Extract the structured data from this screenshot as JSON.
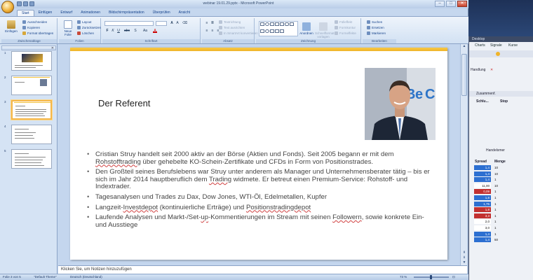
{
  "window": {
    "title": "webinar 19.01.29.pptx - Microsoft PowerPoint",
    "minimize": "–",
    "maximize": "□",
    "close": "✕"
  },
  "ribbon": {
    "tabs": [
      "Start",
      "Einfügen",
      "Entwurf",
      "Animationen",
      "Bildschirmpräsentation",
      "Überprüfen",
      "Ansicht"
    ],
    "active_tab": "Start",
    "clipboard": {
      "paste": "Einfügen",
      "cut": "Ausschneiden",
      "copy": "Kopieren",
      "format_painter": "Format übertragen",
      "group_label": "Zwischenablage"
    },
    "slides": {
      "new_slide": "Neue Folie",
      "layout": "Layout",
      "reset": "Zurücksetzen",
      "delete": "Löschen",
      "group_label": "Folien"
    },
    "font": {
      "group_label": "Schriftart",
      "bold": "F",
      "italic": "K",
      "underline": "U",
      "strike": "abc",
      "shadow": "S",
      "case": "Aa",
      "color": "A"
    },
    "paragraph": {
      "text_direction": "Textrichtung",
      "align_text": "Text ausrichten",
      "smartart": "In SmartArt konvertieren",
      "group_label": "Absatz"
    },
    "drawing": {
      "arrange": "Anordnen",
      "quick_styles": "Schnellformat-vorlagen",
      "fill": "Fülleffekt",
      "outline": "Formkontur",
      "effects": "Formeffekte",
      "group_label": "Zeichnung"
    },
    "editing": {
      "find": "Suchen",
      "replace": "Ersetzen",
      "select": "Markieren",
      "group_label": "Bearbeiten"
    }
  },
  "thumbnails": [
    {
      "number": "1"
    },
    {
      "number": "2"
    },
    {
      "number": "3",
      "selected": true
    },
    {
      "number": "4"
    },
    {
      "number": "5"
    }
  ],
  "slide": {
    "title": "Der Referent",
    "bullets": [
      {
        "parts": [
          "Cristian Struy handelt seit 2000 aktiv an der Börse (Aktien und Fonds). Seit 2005 begann er mit dem ",
          "Rohstofftrading",
          " über gehebelte KO-Schein-Zertifikate und CFDs in Form von Positionstrades."
        ]
      },
      {
        "parts": [
          "Den Großteil seines Berufslebens war Struy unter anderem als Manager und Unternehmensberater tätig – bis er sich im Jahr 2014 hauptberuflich dem ",
          "Trading",
          " widmete. Er betreut einen Premium-Service: Rohstoff- und Indextrader."
        ]
      },
      {
        "parts": [
          "Tagesanalysen und Trades zu Dax, Dow Jones, WTI-Öl, Edelmetallen, Kupfer"
        ]
      },
      {
        "parts": [
          "Langzeit-",
          "Investdepot",
          " (kontinuierliche Erträge) und ",
          "Positionstradingdepot",
          ""
        ]
      },
      {
        "parts": [
          "Laufende Analysen und Markt-/Set-",
          "up",
          "-Kommentierungen im Stream mit seinen ",
          "Followern",
          ", sowie konkrete Ein- und Ausstiege"
        ]
      }
    ]
  },
  "notes": {
    "placeholder": "Klicken Sie, um Notizen hinzuzufügen"
  },
  "statusbar": {
    "slide_info": "Folie 3 von 5",
    "theme": "\"Default Theme\"",
    "language": "Deutsch (Deutschland)",
    "zoom": "73 %"
  },
  "trader": {
    "title": "Desktop",
    "menu": [
      "Charts",
      "Signale",
      "Kurse"
    ],
    "tab_label": "Handlung",
    "search_text": "Zusammenf.",
    "col_sl": "Schlu...",
    "col_stop": "Stop",
    "col_spread": "Spread",
    "col_menge": "Menge",
    "handel_label": "Handelsmer",
    "quotes": [
      {
        "spread": "1,4",
        "menge": "10",
        "color": "#2c6fd1"
      },
      {
        "spread": "1,4",
        "menge": "10",
        "color": "#2c6fd1"
      },
      {
        "spread": "1,4",
        "menge": "1",
        "color": "#2c6fd1"
      },
      {
        "spread": "11,00",
        "menge": "10",
        "color": "#ffffff"
      },
      {
        "spread": "0,09",
        "menge": "1",
        "color": "#c23030"
      },
      {
        "spread": "1,8",
        "menge": "1",
        "color": "#2c6fd1"
      },
      {
        "spread": "1,75",
        "menge": "1",
        "color": "#2c6fd1"
      },
      {
        "spread": "1,8",
        "menge": "1",
        "color": "#c23030"
      },
      {
        "spread": "3,3",
        "menge": "1",
        "color": "#c23030"
      },
      {
        "spread": "2,0",
        "menge": "1",
        "color": "#ffffff"
      },
      {
        "spread": "3,0",
        "menge": "1",
        "color": "#ffffff"
      },
      {
        "spread": "1,4",
        "menge": "1",
        "color": "#2c6fd1"
      },
      {
        "spread": "1,4",
        "menge": "50",
        "color": "#2c6fd1"
      }
    ]
  },
  "colors": {
    "accent_bar": "#f0b429",
    "ribbon_bg": "#dbe8f7",
    "slide_text": "#444444"
  }
}
